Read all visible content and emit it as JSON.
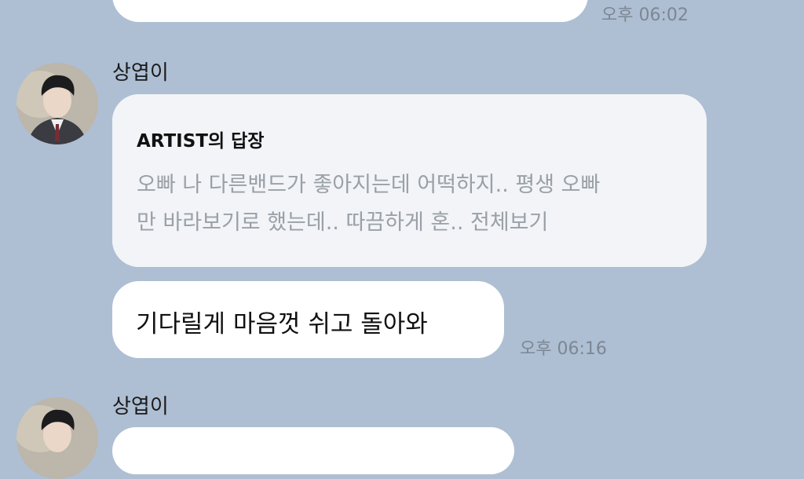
{
  "messages": [
    {
      "timestamp": "오후 06:02"
    },
    {
      "sender": "상엽이",
      "reply": {
        "title": "ARTIST의 답장",
        "quote_line1": "오빠 나 다른밴드가 좋아지는데 어떡하지.. 평생 오빠",
        "quote_line2": "만 바라보기로 했는데.. 따끔하게 혼.. 전체보기"
      },
      "text": "기다릴게 마음껏 쉬고 돌아와",
      "timestamp": "오후 06:16"
    },
    {
      "sender": "상엽이"
    }
  ],
  "colors": {
    "background": "#aebfd3",
    "bubble": "#ffffff",
    "reply_card": "#f2f4f7",
    "timestamp": "#7c8795"
  },
  "icons": {
    "avatar": "profile-photo"
  }
}
